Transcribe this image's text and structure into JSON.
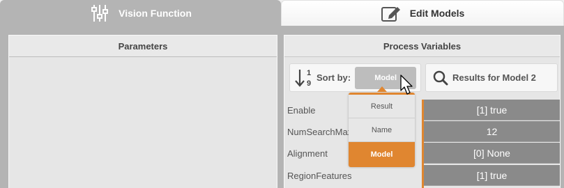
{
  "tabs": {
    "vision": {
      "label": "Vision Function",
      "icon": "sliders-icon"
    },
    "edit": {
      "label": "Edit Models",
      "icon": "edit-icon"
    }
  },
  "parameters": {
    "title": "Parameters"
  },
  "process_variables": {
    "title": "Process Variables",
    "sort": {
      "number_top": "1",
      "number_bottom": "9",
      "label": "Sort by:",
      "selected": "Model",
      "options": [
        "Result",
        "Name",
        "Model"
      ]
    },
    "results": {
      "label": "Results for Model 2",
      "icon": "search-icon"
    },
    "rows": [
      {
        "name": "Enable",
        "value": "[1] true"
      },
      {
        "name": "NumSearchMax",
        "value": "12"
      },
      {
        "name": "Alignment",
        "value": "[0] None"
      },
      {
        "name": "RegionFeatures",
        "value": "[1] true"
      }
    ]
  },
  "colors": {
    "accent": "#e08630",
    "value_bg": "#8a8a8a",
    "tab_inactive": "#b4b4b4"
  }
}
